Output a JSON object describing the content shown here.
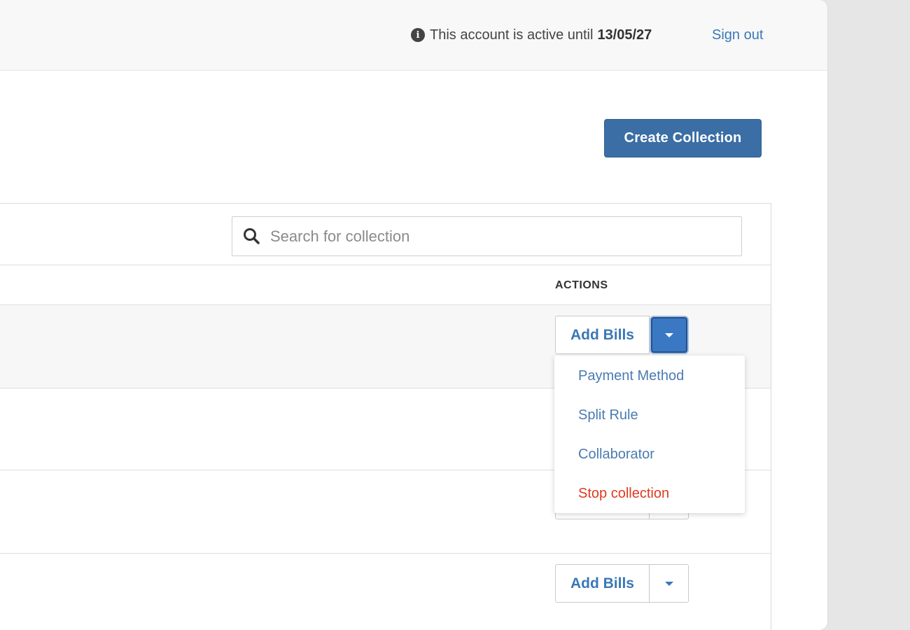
{
  "header": {
    "status_text": "This account is active until",
    "active_until": "13/05/27",
    "sign_out_label": "Sign out"
  },
  "toolbar": {
    "create_label": "Create Collection"
  },
  "search": {
    "placeholder": "Search for collection",
    "value": ""
  },
  "table": {
    "actions_header": "ACTIONS",
    "add_bills_label": "Add Bills"
  },
  "dropdown": {
    "items": [
      {
        "label": "Payment Method"
      },
      {
        "label": "Split Rule"
      },
      {
        "label": "Collaborator"
      },
      {
        "label": "Stop collection"
      }
    ]
  },
  "colors": {
    "link": "#3a78b6",
    "primary_button": "#3a6ea5",
    "danger": "#e03a1f"
  },
  "icons": {
    "info": "info-icon",
    "search": "search-icon",
    "caret": "caret-down-icon"
  }
}
